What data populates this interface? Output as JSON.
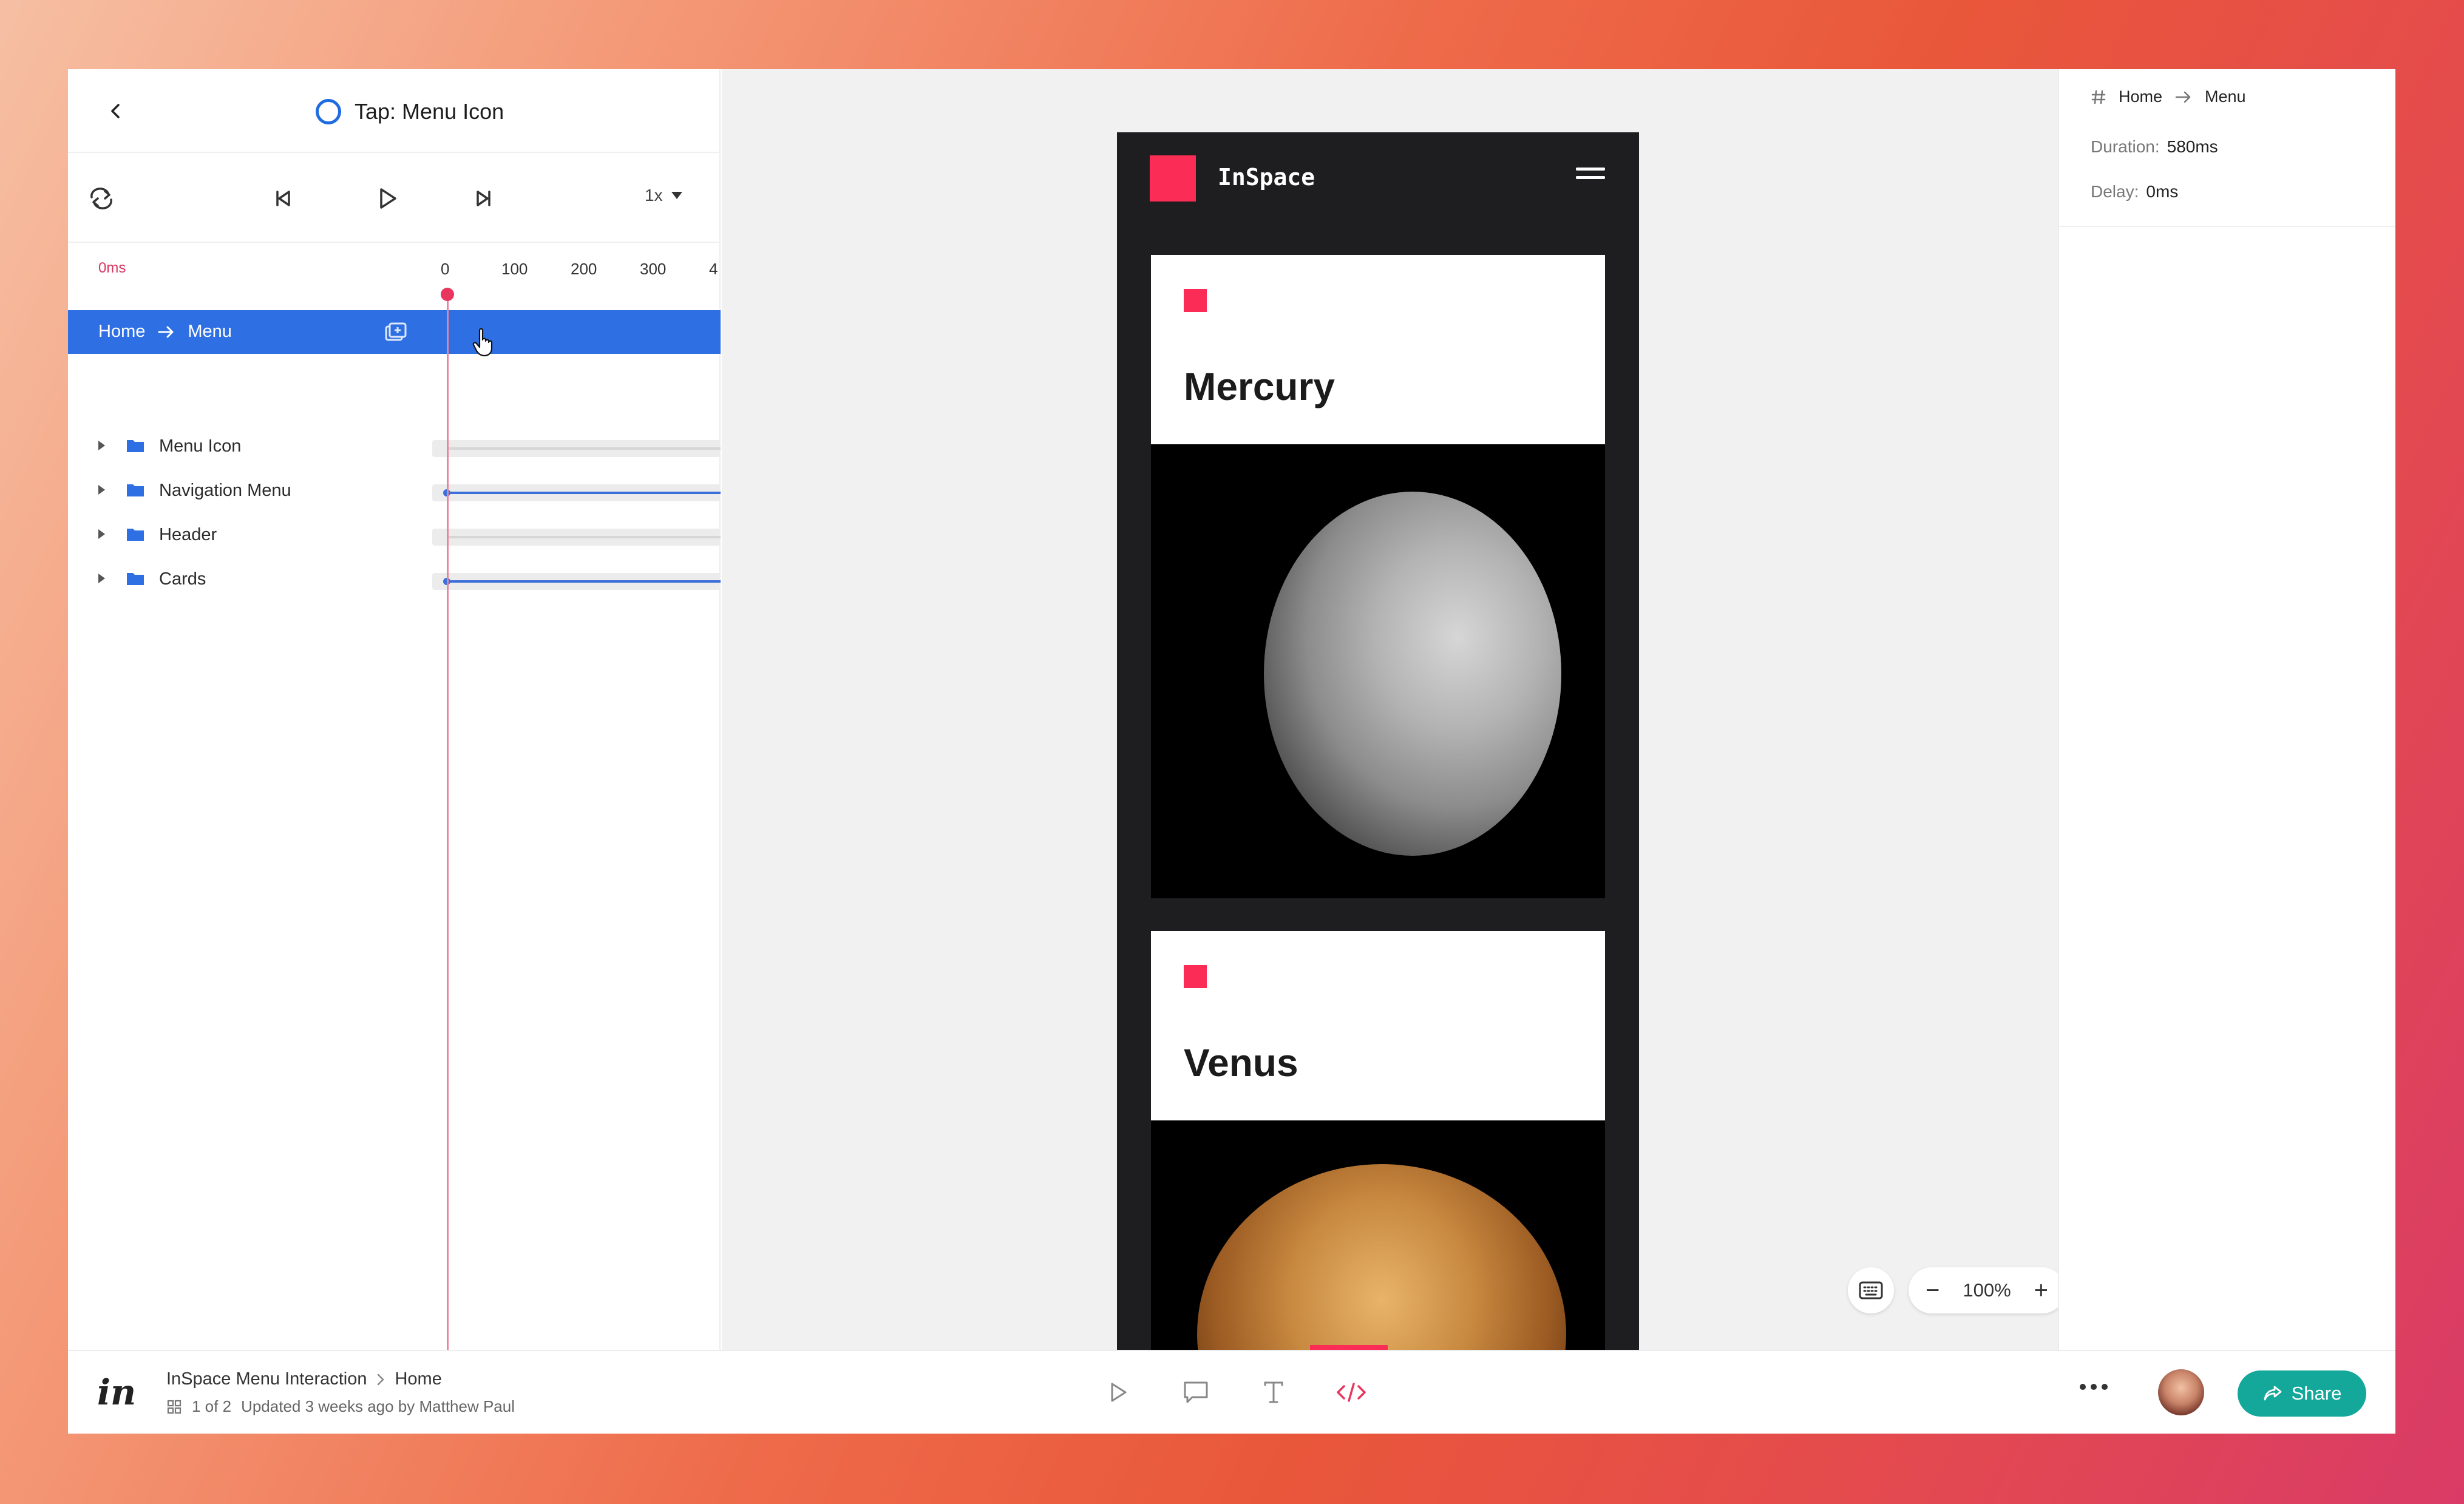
{
  "interaction": {
    "title": "Tap: Menu Icon"
  },
  "playback": {
    "speed": "1x"
  },
  "timeline": {
    "current_time": "0ms",
    "ticks": [
      "0",
      "100",
      "200",
      "300",
      "4"
    ],
    "active_transition": {
      "from": "Home",
      "to": "Menu"
    },
    "layers": [
      {
        "name": "Menu Icon",
        "animated": false
      },
      {
        "name": "Navigation Menu",
        "animated": true
      },
      {
        "name": "Header",
        "animated": false
      },
      {
        "name": "Cards",
        "animated": true
      }
    ]
  },
  "prototype": {
    "brand": "InSpace",
    "cards": [
      {
        "title": "Mercury"
      },
      {
        "title": "Venus"
      }
    ]
  },
  "canvas": {
    "zoom": "100%",
    "zoom_out": "−",
    "zoom_in": "+"
  },
  "inspector": {
    "from": "Home",
    "to": "Menu",
    "duration_label": "Duration:",
    "duration_value": "580ms",
    "delay_label": "Delay:",
    "delay_value": "0ms"
  },
  "footer": {
    "logo": "in",
    "project": "InSpace Menu Interaction",
    "screen": "Home",
    "position": "1 of 2",
    "updated": "Updated 3 weeks ago by Matthew Paul",
    "share_label": "Share"
  },
  "colors": {
    "accent_blue": "#2f6fe4",
    "brand_pink": "#fb2c55",
    "share_teal": "#13a89a"
  }
}
